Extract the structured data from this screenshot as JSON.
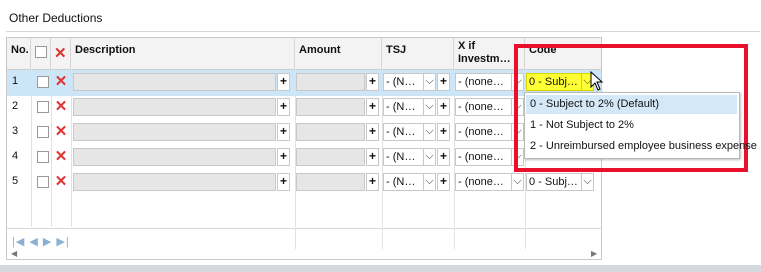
{
  "panel": {
    "title": "Other Deductions"
  },
  "columns": {
    "no": "No.",
    "description": "Description",
    "amount": "Amount",
    "tsj": "TSJ",
    "investment": "X if Investm…",
    "code": "Code"
  },
  "rows": [
    {
      "no": "1",
      "tsj": "- (N…",
      "investment": "- (none…",
      "code": "0 - Subj…",
      "selected": true
    },
    {
      "no": "2",
      "tsj": "- (N…",
      "investment": "- (none…",
      "code": ""
    },
    {
      "no": "3",
      "tsj": "- (N…",
      "investment": "- (none…",
      "code": ""
    },
    {
      "no": "4",
      "tsj": "- (N…",
      "investment": "- (none…",
      "code": ""
    },
    {
      "no": "5",
      "tsj": "- (N…",
      "investment": "- (none…",
      "code": "0 - Subj…"
    }
  ],
  "code_dropdown": {
    "options": [
      "0 - Subject to 2% (Default)",
      "1 - Not Subject to 2%",
      "2 - Unreimbursed employee business expense"
    ],
    "highlighted_index": 0
  },
  "glyphs": {
    "plus": "+",
    "chevron": "⌵",
    "delete": "✕",
    "nav": "|◀ ◀ ▶ ▶|",
    "scroll_left": "◀",
    "scroll_right": "▶"
  },
  "colors": {
    "highlight": "#ffff33",
    "annotation": "#e8102b",
    "selected_row": "#cde6f7"
  }
}
